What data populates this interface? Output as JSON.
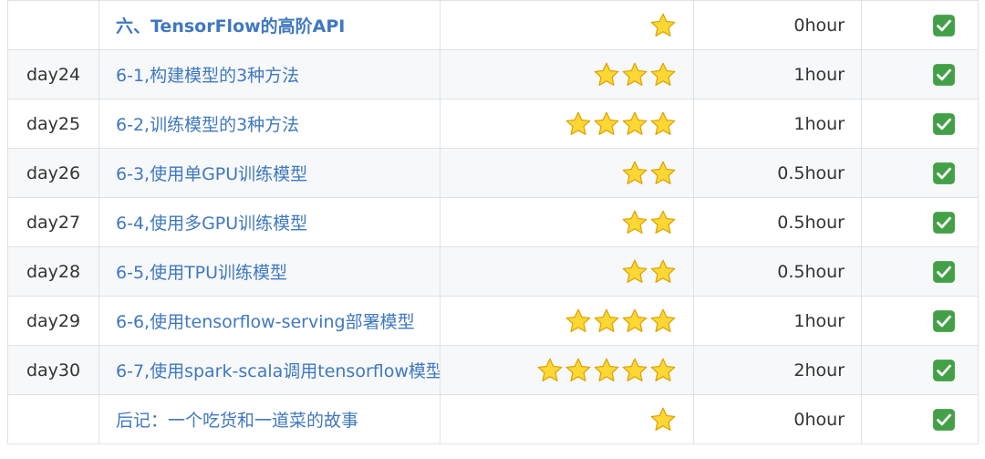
{
  "rows": [
    {
      "day": "",
      "title": "六、TensorFlow的高阶API",
      "bold": true,
      "stars": 1,
      "hours": "0hour",
      "done": true
    },
    {
      "day": "day24",
      "title": "6-1,构建模型的3种方法",
      "bold": false,
      "stars": 3,
      "hours": "1hour",
      "done": true
    },
    {
      "day": "day25",
      "title": "6-2,训练模型的3种方法",
      "bold": false,
      "stars": 4,
      "hours": "1hour",
      "done": true
    },
    {
      "day": "day26",
      "title": "6-3,使用单GPU训练模型",
      "bold": false,
      "stars": 2,
      "hours": "0.5hour",
      "done": true
    },
    {
      "day": "day27",
      "title": "6-4,使用多GPU训练模型",
      "bold": false,
      "stars": 2,
      "hours": "0.5hour",
      "done": true
    },
    {
      "day": "day28",
      "title": "6-5,使用TPU训练模型",
      "bold": false,
      "stars": 2,
      "hours": "0.5hour",
      "done": true
    },
    {
      "day": "day29",
      "title": "6-6,使用tensorflow-serving部署模型",
      "bold": false,
      "stars": 4,
      "hours": "1hour",
      "done": true
    },
    {
      "day": "day30",
      "title": "6-7,使用spark-scala调用tensorflow模型",
      "bold": false,
      "stars": 5,
      "hours": "2hour",
      "done": true
    },
    {
      "day": "",
      "title": "后记：一个吃货和一道菜的故事",
      "bold": false,
      "stars": 1,
      "hours": "0hour",
      "done": true
    }
  ],
  "icons": {
    "star": "star-icon",
    "check": "check-icon"
  },
  "colors": {
    "link": "#4078c0",
    "star_fill": "#fdd835",
    "star_stroke": "#e0a100",
    "check_bg": "#43a047",
    "row_alt": "#f6f8fa",
    "border": "#dfe2e5"
  }
}
